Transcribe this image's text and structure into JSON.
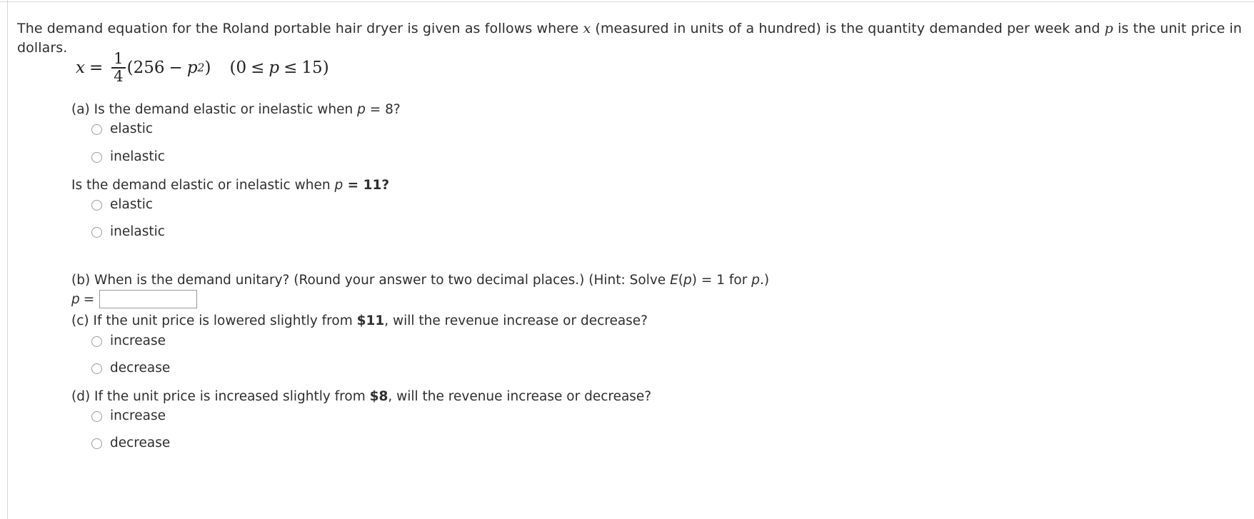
{
  "problem": {
    "intro_part1": "The demand equation for the Roland portable hair dryer is given as follows where ",
    "intro_var_x": "x",
    "intro_part2": " (measured in units of a hundred) is the quantity demanded per week and ",
    "intro_var_p": "p",
    "intro_part3": " is the unit price in dollars.",
    "equation": {
      "lhs_var": "x",
      "equals": "=",
      "fraction_numerator": "1",
      "fraction_denominator": "4",
      "open_paren": "(",
      "constant": "256",
      "minus": "−",
      "var_p": "p",
      "exponent": "2",
      "close_paren": ")",
      "domain_open": "(",
      "domain_lower": "0",
      "domain_le1": "≤",
      "domain_var": "p",
      "domain_le2": "≤",
      "domain_upper": "15",
      "domain_close": ")",
      "plain_text": "x = (1/4)(256 − p²)   (0 ≤ p ≤ 15)"
    }
  },
  "parts": {
    "a": {
      "label": "(a)",
      "question1_pre": "(a) Is the demand elastic or inelastic when ",
      "question1_var": "p",
      "question1_post": " = 8?",
      "question1_value": "8",
      "options1": [
        {
          "label": "elastic",
          "selected": false
        },
        {
          "label": "inelastic",
          "selected": false
        }
      ],
      "question2_pre": "Is the demand elastic or inelastic when ",
      "question2_var": "p",
      "question2_post": " = 11?",
      "question2_value": "11",
      "options2": [
        {
          "label": "elastic",
          "selected": false
        },
        {
          "label": "inelastic",
          "selected": false
        }
      ]
    },
    "b": {
      "question_pre": "(b) When is the demand unitary? (Round your answer to two decimal places.) (Hint: Solve ",
      "question_func": "E",
      "question_mid": "(",
      "question_var": "p",
      "question_post": ") = 1 for ",
      "question_var2": "p",
      "question_end": ".)",
      "answer_var": "p",
      "answer_equals": "=",
      "answer_value": "",
      "answer_placeholder": ""
    },
    "c": {
      "question_pre": "(c) If the unit price is lowered slightly from ",
      "question_amount": "$11",
      "question_post": ", will the revenue increase or decrease?",
      "options": [
        {
          "label": "increase",
          "selected": false
        },
        {
          "label": "decrease",
          "selected": false
        }
      ]
    },
    "d": {
      "question_pre": "(d) If the unit price is increased slightly from ",
      "question_amount": "$8",
      "question_post": ", will the revenue increase or decrease?",
      "options": [
        {
          "label": "increase",
          "selected": false
        },
        {
          "label": "decrease",
          "selected": false
        }
      ]
    }
  },
  "colors": {
    "text": "#2e2e2e",
    "rule": "#d6d6d6",
    "radio_border": "#9b9b9b",
    "input_border": "#9a9a9a",
    "background": "#ffffff"
  }
}
